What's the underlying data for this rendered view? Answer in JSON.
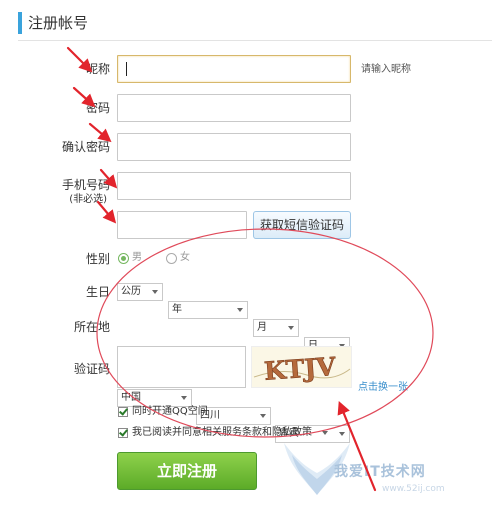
{
  "header": {
    "title": "注册帐号"
  },
  "form": {
    "nickname": {
      "label": "昵称",
      "value": "",
      "hint": "请输入昵称"
    },
    "password": {
      "label": "密码",
      "value": ""
    },
    "confirm_password": {
      "label": "确认密码",
      "value": ""
    },
    "phone": {
      "label": "手机号码",
      "sub_label": "(非必选)",
      "value": ""
    },
    "sms_code": {
      "value": "",
      "button_label": "获取短信验证码"
    },
    "gender": {
      "label": "性别",
      "options": [
        "男",
        "女"
      ],
      "selected": "男"
    },
    "birthday": {
      "label": "生日",
      "calendar": "公历",
      "year": "年",
      "month": "月",
      "day": "日"
    },
    "location": {
      "label": "所在地",
      "country": "中国",
      "province": "四川",
      "city": "宜宾"
    },
    "captcha": {
      "label": "验证码",
      "image_text": "KTJV",
      "refresh_link": "点击换一张"
    },
    "options": {
      "open_qq_space": {
        "label": "同时开通QQ空间",
        "checked": true
      },
      "agree_terms": {
        "label": "我已阅读并同意相关服务条款和隐私政策",
        "checked": true
      }
    },
    "submit_label": "立即注册"
  },
  "watermark": {
    "text": "我爱IT技术网",
    "url": "www.52ij.com"
  },
  "annotation_colors": {
    "arrow": "#e2242c",
    "circle": "#e04a5a"
  }
}
